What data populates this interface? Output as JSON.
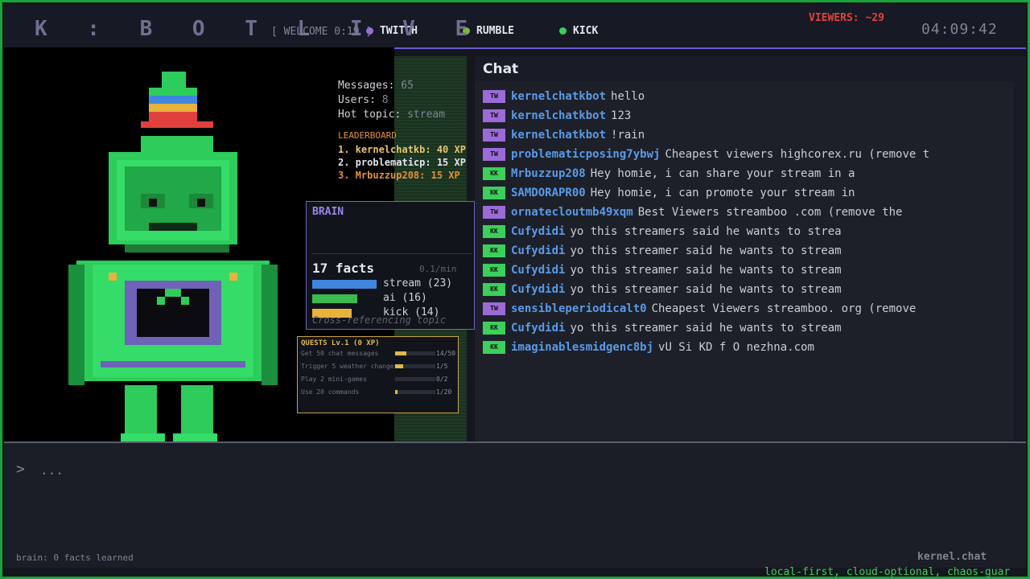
{
  "header": {
    "logo": "K : B O T   L I V E",
    "welcome": "[ WELCOME 0:19 ]",
    "platforms": [
      {
        "label": "TWITCH",
        "color": "#9b6bd8"
      },
      {
        "label": "RUMBLE",
        "color": "#7db83c"
      },
      {
        "label": "KICK",
        "color": "#3ccf5a"
      }
    ],
    "viewers": "VIEWERS: ~29",
    "clock": "04:09:42"
  },
  "stats": {
    "messages_label": "Messages:",
    "messages_value": "65",
    "users_label": "Users:",
    "users_value": "8",
    "topic_label": "Hot topic:",
    "topic_value": "stream"
  },
  "leaderboard": {
    "title": "LEADERBOARD",
    "entries": [
      "1. kernelchatkb: 40 XP",
      "2. problematicp: 15 XP",
      "3. Mrbuzzup208: 15 XP"
    ]
  },
  "brain": {
    "title": "BRAIN",
    "facts": "17 facts",
    "rate": "0.1/min",
    "topics": [
      {
        "label": "stream (23)",
        "value": 23,
        "color": "#3f86e0"
      },
      {
        "label": "ai (16)",
        "value": 16,
        "color": "#3dba4f"
      },
      {
        "label": "kick (14)",
        "value": 14,
        "color": "#e8b23d"
      }
    ],
    "footer": "Cross-referencing topic"
  },
  "quests": {
    "title": "QUESTS  Lv.1 (0 XP)",
    "items": [
      {
        "label": "Get 50 chat messages",
        "count": "14/50",
        "progress": 0.28
      },
      {
        "label": "Trigger 5 weather changes",
        "count": "1/5",
        "progress": 0.2
      },
      {
        "label": "Play 2 mini-games",
        "count": "0/2",
        "progress": 0
      },
      {
        "label": "Use 20 commands",
        "count": "1/20",
        "progress": 0.05
      }
    ]
  },
  "chat": {
    "title": "Chat",
    "badge_colors": {
      "TW": "#9b6bd8",
      "KK": "#3ccf5a"
    },
    "messages": [
      {
        "badge": "TW",
        "user": "kernelchatkbot",
        "text": "hello"
      },
      {
        "badge": "TW",
        "user": "kernelchatkbot",
        "text": "123"
      },
      {
        "badge": "TW",
        "user": "kernelchatkbot",
        "text": "!rain"
      },
      {
        "badge": "TW",
        "user": "problematicposing7ybwj",
        "text": "Cheapest viewers  highcorex.ru (remove t"
      },
      {
        "badge": "KK",
        "user": "Mrbuzzup208",
        "text": "Hey homie, i can share your stream in a"
      },
      {
        "badge": "KK",
        "user": "SAMDORAPR00",
        "text": "Hey homie, i can promote your stream in"
      },
      {
        "badge": "TW",
        "user": "ornatecloutmb49xqm",
        "text": "Best Viewers streamboo .com (remove the"
      },
      {
        "badge": "KK",
        "user": "Cufydidi",
        "text": "yo this streamers said he wants to strea"
      },
      {
        "badge": "KK",
        "user": "Cufydidi",
        "text": "yo this streamer said he wants to stream"
      },
      {
        "badge": "KK",
        "user": "Cufydidi",
        "text": "yo this streamer said he wants to stream"
      },
      {
        "badge": "KK",
        "user": "Cufydidi",
        "text": "yo this streamer said he wants to stream"
      },
      {
        "badge": "TW",
        "user": "sensibleperiodicalt0",
        "text": "Cheapest Viewers streamboo. org (remove"
      },
      {
        "badge": "KK",
        "user": "Cufydidi",
        "text": "yo this streamer said he wants to stream"
      },
      {
        "badge": "KK",
        "user": "imaginablesmidgenc8bj",
        "text": "vU Si KD f O nezhna.com"
      }
    ]
  },
  "input": {
    "prompt": ">",
    "text": "...",
    "brain_status": "brain: 0 facts learned",
    "brand": "kernel.chat",
    "tagline": "local-first, cloud-optional, chaos-guar"
  }
}
